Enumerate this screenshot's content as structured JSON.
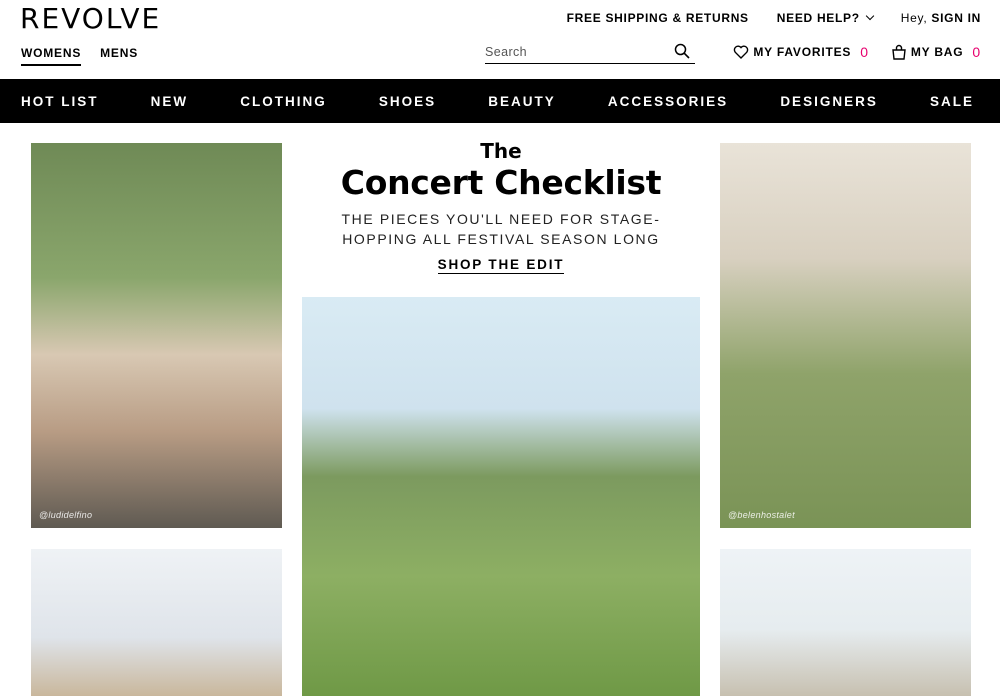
{
  "header": {
    "logo": "REVOLVE",
    "gender_tabs": [
      {
        "label": "WOMENS",
        "active": true
      },
      {
        "label": "MENS",
        "active": false
      }
    ],
    "utility": {
      "shipping": "FREE SHIPPING & RETURNS",
      "help": "NEED HELP?",
      "greeting": "Hey,",
      "sign_in": "SIGN IN"
    },
    "search": {
      "placeholder": "Search",
      "icon": "search-icon"
    },
    "favorites": {
      "label": "MY FAVORITES",
      "count": "0",
      "icon": "heart-icon"
    },
    "bag": {
      "label": "MY BAG",
      "count": "0",
      "icon": "bag-icon"
    },
    "accent_color": "#e7006e"
  },
  "main_nav": {
    "items": [
      "HOT LIST",
      "NEW",
      "CLOTHING",
      "SHOES",
      "BEAUTY",
      "ACCESSORIES",
      "DESIGNERS",
      "SALE"
    ]
  },
  "editorial": {
    "kicker": "The",
    "title": "Concert Checklist",
    "subtitle_line1": "THE PIECES YOU'LL NEED FOR STAGE-",
    "subtitle_line2": "HOPPING ALL FESTIVAL SEASON LONG",
    "cta": "SHOP THE EDIT"
  },
  "photos": {
    "left_top_credit": "@ludidelfino",
    "right_top_credit": "@belenhostalet"
  }
}
